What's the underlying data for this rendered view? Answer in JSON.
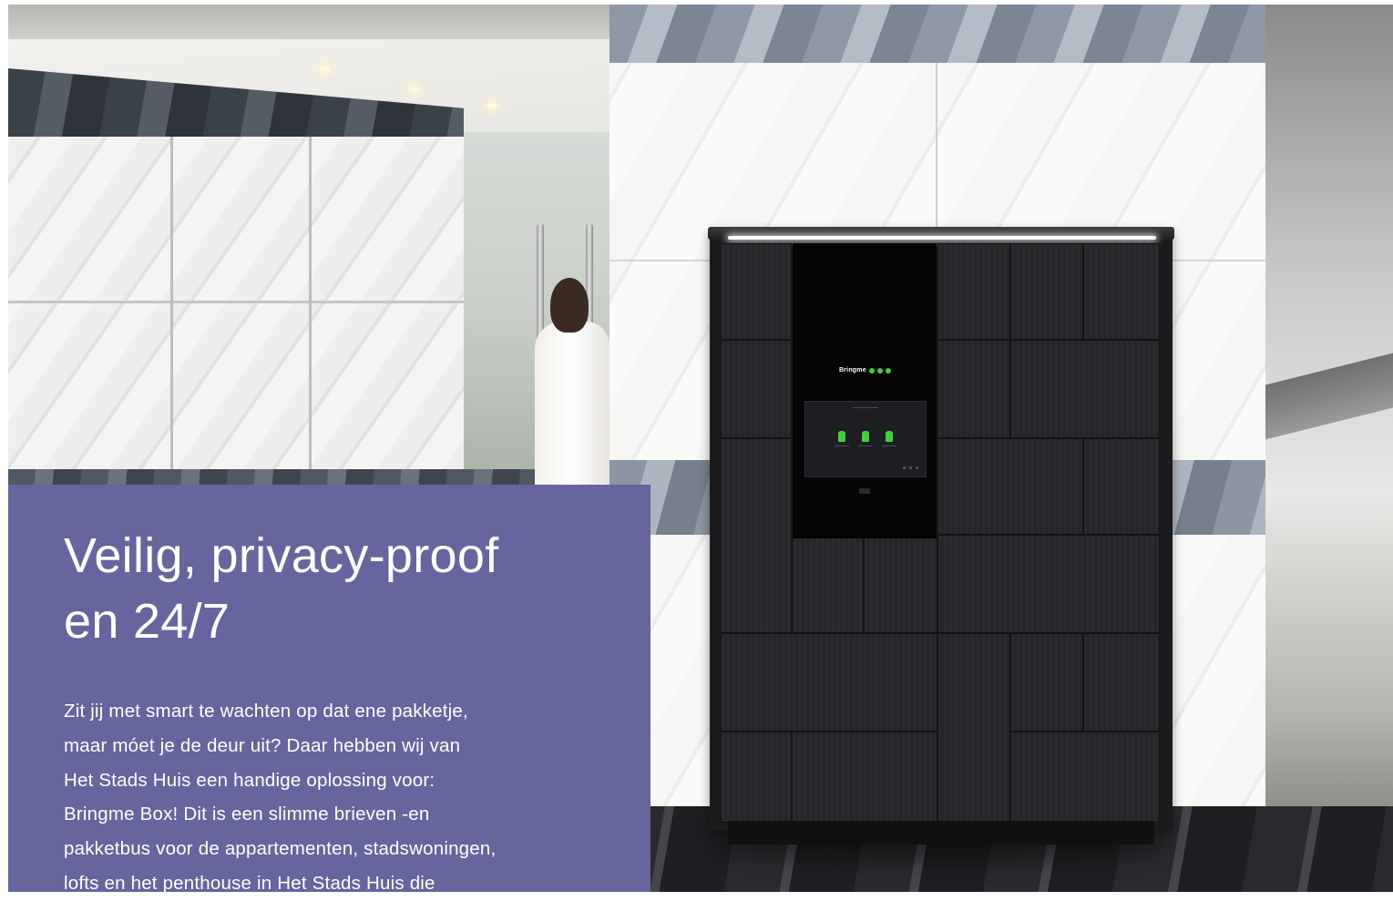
{
  "heading": {
    "line1": "Veilig, privacy-proof",
    "line2": "en 24/7"
  },
  "body_lines": [
    "Zit jij met smart te wachten op dat ene pakketje,",
    "maar móet je de deur uit? Daar hebben wij van",
    "Het Stads Huis een handige oplossing voor:",
    "Bringme Box! Dit is een slimme brieven -en",
    "pakketbus voor de appartementen, stadswoningen,",
    "lofts en het penthouse in Het Stads Huis die"
  ],
  "locker": {
    "brand": "Bringme"
  },
  "colors": {
    "card_background": "#66659d",
    "brand_green": "#3fd13b"
  }
}
